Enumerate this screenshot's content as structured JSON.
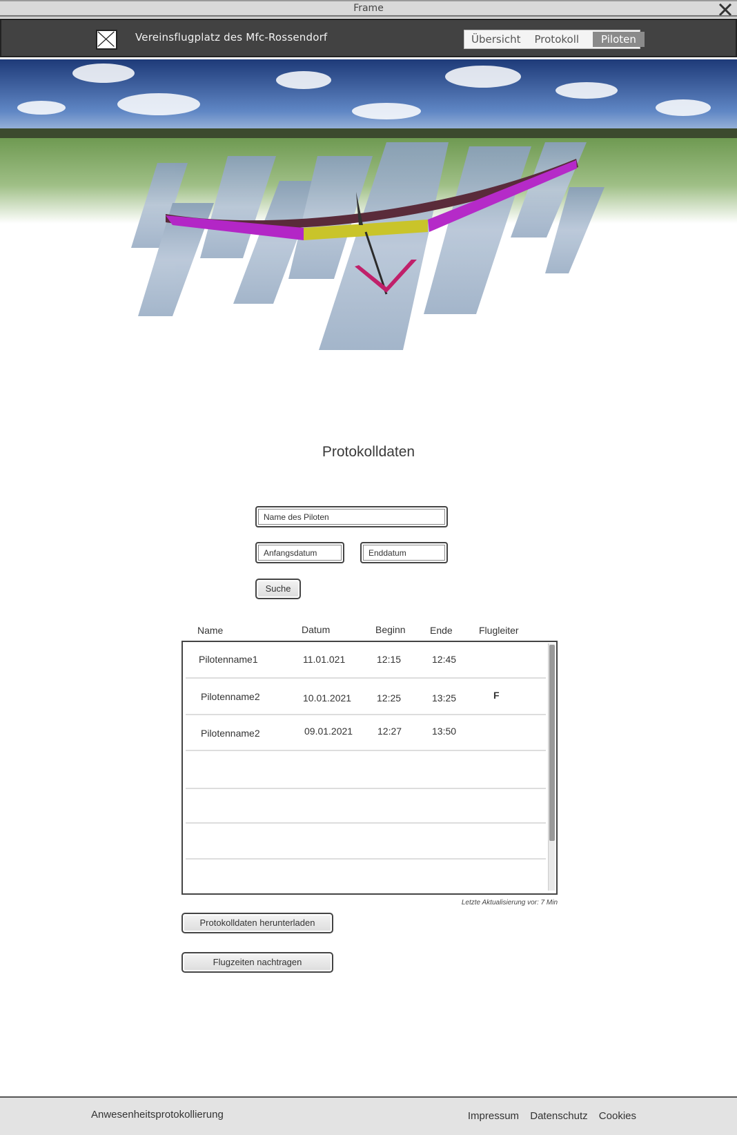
{
  "frame": {
    "title": "Frame"
  },
  "header": {
    "site_title": "Vereinsflugplatz des Mfc-Rossendorf",
    "nav": [
      {
        "label": "Übersicht",
        "active": false
      },
      {
        "label": "Protokoll",
        "active": false
      },
      {
        "label": "Piloten",
        "active": true
      }
    ]
  },
  "main": {
    "title": "Protokolldaten",
    "search": {
      "pilot_placeholder": "Name des Piloten",
      "start_placeholder": "Anfangsdatum",
      "end_placeholder": "Enddatum",
      "button": "Suche"
    },
    "table": {
      "headers": [
        "Name",
        "Datum",
        "Beginn",
        "Ende",
        "Flugleiter"
      ],
      "rows": [
        {
          "name": "Pilotenname1",
          "date": "11.01.021",
          "begin": "12:15",
          "end": "12:45",
          "lead": ""
        },
        {
          "name": "Pilotenname2",
          "date": "10.01.2021",
          "begin": "12:25",
          "end": "13:25",
          "lead": "F"
        },
        {
          "name": "Pilotenname2",
          "date": "09.01.2021",
          "begin": "12:27",
          "end": "13:50",
          "lead": ""
        },
        {
          "name": "",
          "date": "",
          "begin": "",
          "end": "",
          "lead": ""
        },
        {
          "name": "",
          "date": "",
          "begin": "",
          "end": "",
          "lead": ""
        },
        {
          "name": "",
          "date": "",
          "begin": "",
          "end": "",
          "lead": ""
        },
        {
          "name": "",
          "date": "",
          "begin": "",
          "end": "",
          "lead": ""
        }
      ]
    },
    "last_update": "Letzte Aktualisierung vor: 7 Min",
    "download_button": "Protokolldaten herunterladen",
    "add_times_button": "Flugzeiten nachtragen"
  },
  "footer": {
    "left": "Anwesenheitsprotokollierung",
    "links": [
      "Impressum",
      "Datenschutz",
      "Cookies"
    ]
  },
  "icons": {
    "close": "close-icon",
    "logo": "image-placeholder-icon",
    "hero": "glider-hero-image"
  }
}
